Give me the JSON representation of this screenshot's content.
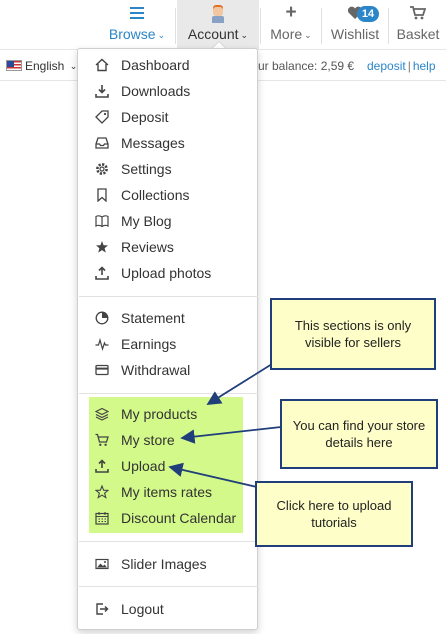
{
  "nav": {
    "browse": {
      "label": "Browse",
      "icon": "hamburger-icon"
    },
    "account": {
      "label": "Account",
      "icon": "avatar-icon"
    },
    "more": {
      "label": "More",
      "icon": "plus-icon"
    },
    "wishlist": {
      "label": "Wishlist",
      "badge": "14",
      "icon": "heart-icon"
    },
    "basket": {
      "label": "Basket",
      "icon": "cart-icon"
    },
    "accent_color": "#2a86c9"
  },
  "subbar": {
    "language": "English",
    "balance": "ur balance: 2,59 €",
    "deposit_link": "deposit",
    "separator": "|",
    "help_link": "help"
  },
  "menu": {
    "group1": [
      {
        "label": "Dashboard",
        "icon": "home-icon"
      },
      {
        "label": "Downloads",
        "icon": "download-icon"
      },
      {
        "label": "Deposit",
        "icon": "tag-icon"
      },
      {
        "label": "Messages",
        "icon": "inbox-icon"
      },
      {
        "label": "Settings",
        "icon": "gear-icon"
      },
      {
        "label": "Collections",
        "icon": "bookmark-icon"
      },
      {
        "label": "My Blog",
        "icon": "book-icon"
      },
      {
        "label": "Reviews",
        "icon": "star-icon"
      },
      {
        "label": "Upload photos",
        "icon": "upload-icon"
      }
    ],
    "group2": [
      {
        "label": "Statement",
        "icon": "pie-chart-icon"
      },
      {
        "label": "Earnings",
        "icon": "pulse-icon"
      },
      {
        "label": "Withdrawal",
        "icon": "credit-card-icon"
      }
    ],
    "group3": [
      {
        "label": "My products",
        "icon": "layers-icon"
      },
      {
        "label": "My store",
        "icon": "cart-icon"
      },
      {
        "label": "Upload",
        "icon": "upload-icon"
      },
      {
        "label": "My items rates",
        "icon": "star-outline-icon"
      },
      {
        "label": "Discount Calendar",
        "icon": "calendar-icon"
      }
    ],
    "group4": [
      {
        "label": "Slider Images",
        "icon": "image-icon"
      }
    ],
    "group5": [
      {
        "label": "Logout",
        "icon": "logout-icon"
      }
    ],
    "highlight_color": "#d3f98a"
  },
  "callouts": {
    "sellers": "This sections is only visible for sellers",
    "store": "You can find your store details here",
    "upload": "Click here to upload tutorials"
  }
}
